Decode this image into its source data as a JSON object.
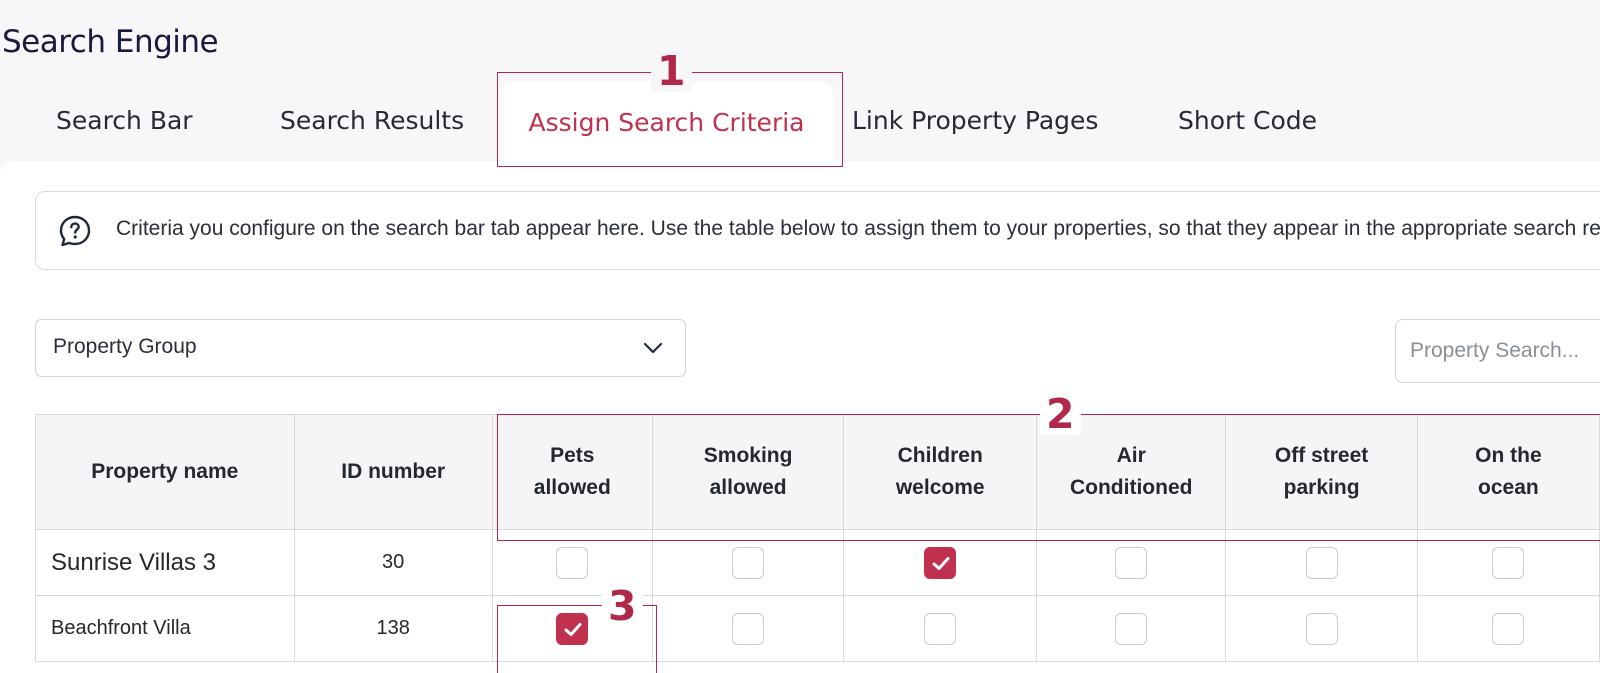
{
  "page": {
    "title": "Search Engine"
  },
  "tabs": [
    {
      "label": "Search Bar",
      "active": false
    },
    {
      "label": "Search Results",
      "active": false
    },
    {
      "label": "Assign Search Criteria",
      "active": true
    },
    {
      "label": "Link Property Pages",
      "active": false
    },
    {
      "label": "Short Code",
      "active": false
    }
  ],
  "info": {
    "icon": "question-bubble-icon",
    "text": "Criteria you configure on the search bar tab appear here. Use the table below to assign them to your properties, so that they appear in the appropriate search results."
  },
  "filters": {
    "group_select": {
      "value": "Property Group",
      "icon": "chevron-down-icon"
    },
    "search": {
      "placeholder": "Property Search..."
    }
  },
  "table": {
    "headers": [
      "Property name",
      "ID number",
      "Pets\nallowed",
      "Smoking\nallowed",
      "Children\nwelcome",
      "Air\nConditioned",
      "Off street\nparking",
      "On the\nocean"
    ],
    "rows": [
      {
        "name": "Sunrise Villas 3",
        "id": "30",
        "checks": [
          false,
          false,
          true,
          false,
          false,
          false
        ]
      },
      {
        "name": "Beachfront Villa",
        "id": "138",
        "checks": [
          true,
          false,
          false,
          false,
          false,
          false
        ]
      }
    ]
  },
  "annotations": {
    "one": "1",
    "two": "2",
    "three": "3"
  },
  "colors": {
    "accent": "#c0304f",
    "annotation": "#b0294a",
    "background": "#f7f7f9"
  }
}
